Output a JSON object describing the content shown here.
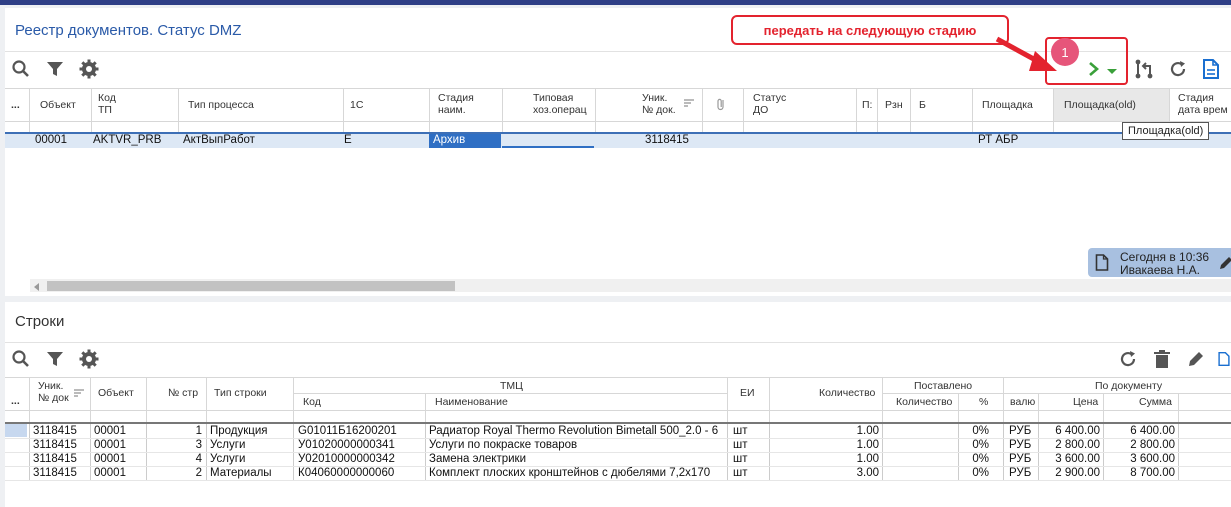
{
  "registry": {
    "title": "Реестр документов. Статус DMZ",
    "columns": {
      "dots": "...",
      "object": "Объект",
      "kod_tp_1": "Код",
      "kod_tp_2": "ТП",
      "process_type": "Тип процесса",
      "c1": "1С",
      "stage_1": "Стадия",
      "stage_2": "наим.",
      "typical_1": "Типовая",
      "typical_2": "хоз.операц",
      "unik_1": "Уник.",
      "unik_2": "№ док.",
      "status_1": "Статус",
      "status_2": "ДО",
      "p": "П:",
      "rzn": "Рзн",
      "b": "Б",
      "site": "Площадка",
      "site_old": "Площадка(old)",
      "stage_date_1": "Стадия",
      "stage_date_2": "дата врем"
    },
    "row": {
      "object": "00001",
      "kod_tp": "AKTVR_PRB",
      "process_type": "АктВыпРабот",
      "c1": "Е",
      "stage": "Архив",
      "unik": "3118415",
      "site": "РТ АБР"
    },
    "tooltip": "Площадка(old)",
    "annotation_text": "передать на следующую стадию",
    "annotation_number": "1",
    "note_time": "Сегодня в 10:36",
    "note_author": "Ивакаева Н.А."
  },
  "lines": {
    "title": "Строки",
    "columns": {
      "dots": "...",
      "unik_1": "Уник.",
      "unik_2": "№ док",
      "object": "Объект",
      "num": "№ стр",
      "line_type": "Тип строки",
      "tmc": "ТМЦ",
      "code": "Код",
      "name": "Наименование",
      "ei": "ЕИ",
      "qty": "Количество",
      "delivered": "Поставлено",
      "del_qty": "Количество",
      "del_pct": "%",
      "by_doc": "По документу",
      "currency": "валю",
      "price": "Цена",
      "sum": "Сумма"
    },
    "rows": [
      {
        "unik": "3118415",
        "object": "00001",
        "num": "1",
        "type": "Продукция",
        "code": "G01011Б16200201",
        "name": "Радиатор Royal Thermo Revolution Bimetall 500_2.0 - 6",
        "ei": "шт",
        "qty": "1.00",
        "pct": "0%",
        "cur": "РУБ",
        "price": "6 400.00",
        "sum": "6 400.00"
      },
      {
        "unik": "3118415",
        "object": "00001",
        "num": "3",
        "type": "Услуги",
        "code": "У01020000000341",
        "name": "Услуги по покраске товаров",
        "ei": "шт",
        "qty": "1.00",
        "pct": "0%",
        "cur": "РУБ",
        "price": "2 800.00",
        "sum": "2 800.00"
      },
      {
        "unik": "3118415",
        "object": "00001",
        "num": "4",
        "type": "Услуги",
        "code": "У02010000000342",
        "name": "Замена электрики",
        "ei": "шт",
        "qty": "1.00",
        "pct": "0%",
        "cur": "РУБ",
        "price": "3 600.00",
        "sum": "3 600.00"
      },
      {
        "unik": "3118415",
        "object": "00001",
        "num": "2",
        "type": "Материалы",
        "code": "К04060000000060",
        "name": "Комплект плоских кронштейнов с дюбелями 7,2х170",
        "ei": "шт",
        "qty": "3.00",
        "pct": "0%",
        "cur": "РУБ",
        "price": "2 900.00",
        "sum": "8 700.00"
      }
    ]
  }
}
